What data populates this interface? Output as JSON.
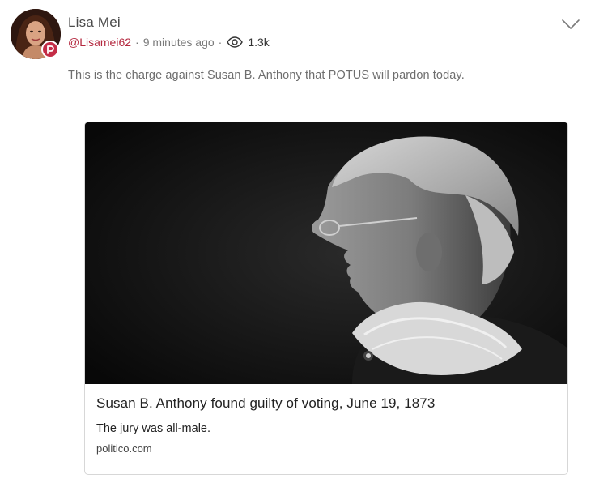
{
  "post": {
    "author": {
      "display_name": "Lisa Mei",
      "handle": "@Lisamei62",
      "avatar_icon": "user-avatar",
      "badge_icon": "parler-p-icon",
      "badge_color": "#c42d47"
    },
    "time_ago": "9 minutes ago",
    "separator": "·",
    "views_icon": "eye-icon",
    "view_count": "1.3k",
    "menu_icon": "chevron-down-icon",
    "text": "This is the charge against Susan B. Anthony that POTUS will pardon today."
  },
  "link_preview": {
    "image_icon": "portrait-photo",
    "title": "Susan B. Anthony found guilty of voting, June 19, 1873",
    "description": "The jury was all-male.",
    "domain": "politico.com"
  },
  "colors": {
    "handle": "#b4283f",
    "text_muted": "#6e6e6e",
    "border": "#d7d7d7"
  }
}
